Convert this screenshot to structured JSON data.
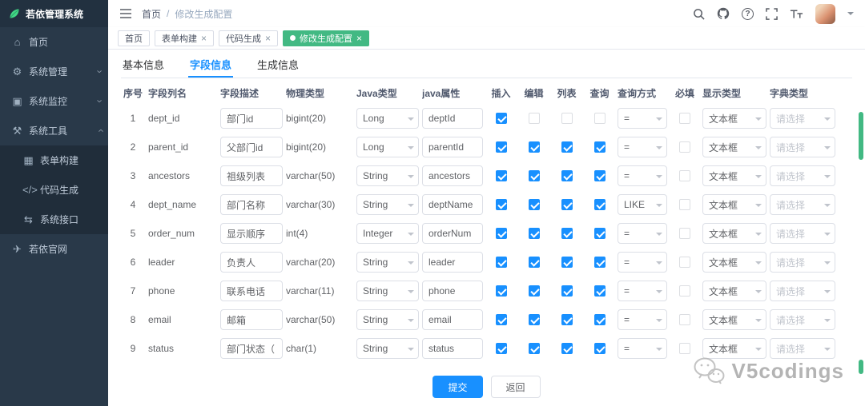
{
  "colors": {
    "accent_green": "#42b983",
    "primary_blue": "#1890ff",
    "sidebar_bg": "#293949",
    "submenu_bg": "#202d3a"
  },
  "icons": {
    "close": "×",
    "chevron": "›",
    "question": "?",
    "home": "⌂",
    "gear": "⚙",
    "monitor": "▣",
    "tools": "⚒",
    "guide": "✈",
    "form_build": "▦",
    "code_gen": "</>",
    "api": "⇆"
  },
  "app": {
    "title": "若依管理系统",
    "watermark": "V5codings"
  },
  "sidebar": {
    "items": [
      {
        "label": "首页"
      },
      {
        "label": "系统管理"
      },
      {
        "label": "系统监控"
      },
      {
        "label": "系统工具"
      },
      {
        "label": "若依官网"
      }
    ],
    "tools_children": [
      {
        "label": "表单构建"
      },
      {
        "label": "代码生成"
      },
      {
        "label": "系统接口"
      }
    ]
  },
  "header": {
    "breadcrumb": {
      "home": "首页",
      "separator": "/",
      "current": "修改生成配置"
    }
  },
  "tags": [
    {
      "label": "首页",
      "closable": false,
      "active": false
    },
    {
      "label": "表单构建",
      "closable": true,
      "active": false
    },
    {
      "label": "代码生成",
      "closable": true,
      "active": false
    },
    {
      "label": "修改生成配置",
      "closable": true,
      "active": true
    }
  ],
  "tabs": [
    {
      "label": "基本信息",
      "active": false
    },
    {
      "label": "字段信息",
      "active": true
    },
    {
      "label": "生成信息",
      "active": false
    }
  ],
  "table": {
    "headers": [
      "序号",
      "字段列名",
      "字段描述",
      "物理类型",
      "Java类型",
      "java属性",
      "插入",
      "编辑",
      "列表",
      "查询",
      "查询方式",
      "必填",
      "显示类型",
      "字典类型"
    ],
    "rows": [
      {
        "index": 1,
        "column": "dept_id",
        "desc": "部门id",
        "physical": "bigint(20)",
        "java_type": "Long",
        "java_prop": "deptId",
        "insert": true,
        "edit": false,
        "list": false,
        "query": false,
        "query_mode": "=",
        "required": false,
        "display": "文本框",
        "dict": "请选择"
      },
      {
        "index": 2,
        "column": "parent_id",
        "desc": "父部门id",
        "physical": "bigint(20)",
        "java_type": "Long",
        "java_prop": "parentId",
        "insert": true,
        "edit": true,
        "list": true,
        "query": true,
        "query_mode": "=",
        "required": false,
        "display": "文本框",
        "dict": "请选择"
      },
      {
        "index": 3,
        "column": "ancestors",
        "desc": "祖级列表",
        "physical": "varchar(50)",
        "java_type": "String",
        "java_prop": "ancestors",
        "insert": true,
        "edit": true,
        "list": true,
        "query": true,
        "query_mode": "=",
        "required": false,
        "display": "文本框",
        "dict": "请选择"
      },
      {
        "index": 4,
        "column": "dept_name",
        "desc": "部门名称",
        "physical": "varchar(30)",
        "java_type": "String",
        "java_prop": "deptName",
        "insert": true,
        "edit": true,
        "list": true,
        "query": true,
        "query_mode": "LIKE",
        "required": false,
        "display": "文本框",
        "dict": "请选择"
      },
      {
        "index": 5,
        "column": "order_num",
        "desc": "显示顺序",
        "physical": "int(4)",
        "java_type": "Integer",
        "java_prop": "orderNum",
        "insert": true,
        "edit": true,
        "list": true,
        "query": true,
        "query_mode": "=",
        "required": false,
        "display": "文本框",
        "dict": "请选择"
      },
      {
        "index": 6,
        "column": "leader",
        "desc": "负责人",
        "physical": "varchar(20)",
        "java_type": "String",
        "java_prop": "leader",
        "insert": true,
        "edit": true,
        "list": true,
        "query": true,
        "query_mode": "=",
        "required": false,
        "display": "文本框",
        "dict": "请选择"
      },
      {
        "index": 7,
        "column": "phone",
        "desc": "联系电话",
        "physical": "varchar(11)",
        "java_type": "String",
        "java_prop": "phone",
        "insert": true,
        "edit": true,
        "list": true,
        "query": true,
        "query_mode": "=",
        "required": false,
        "display": "文本框",
        "dict": "请选择"
      },
      {
        "index": 8,
        "column": "email",
        "desc": "邮箱",
        "physical": "varchar(50)",
        "java_type": "String",
        "java_prop": "email",
        "insert": true,
        "edit": true,
        "list": true,
        "query": true,
        "query_mode": "=",
        "required": false,
        "display": "文本框",
        "dict": "请选择"
      },
      {
        "index": 9,
        "column": "status",
        "desc": "部门状态（",
        "physical": "char(1)",
        "java_type": "String",
        "java_prop": "status",
        "insert": true,
        "edit": true,
        "list": true,
        "query": true,
        "query_mode": "=",
        "required": false,
        "display": "文本框",
        "dict": "请选择"
      }
    ]
  },
  "footer": {
    "submit": "提交",
    "back": "返回"
  }
}
